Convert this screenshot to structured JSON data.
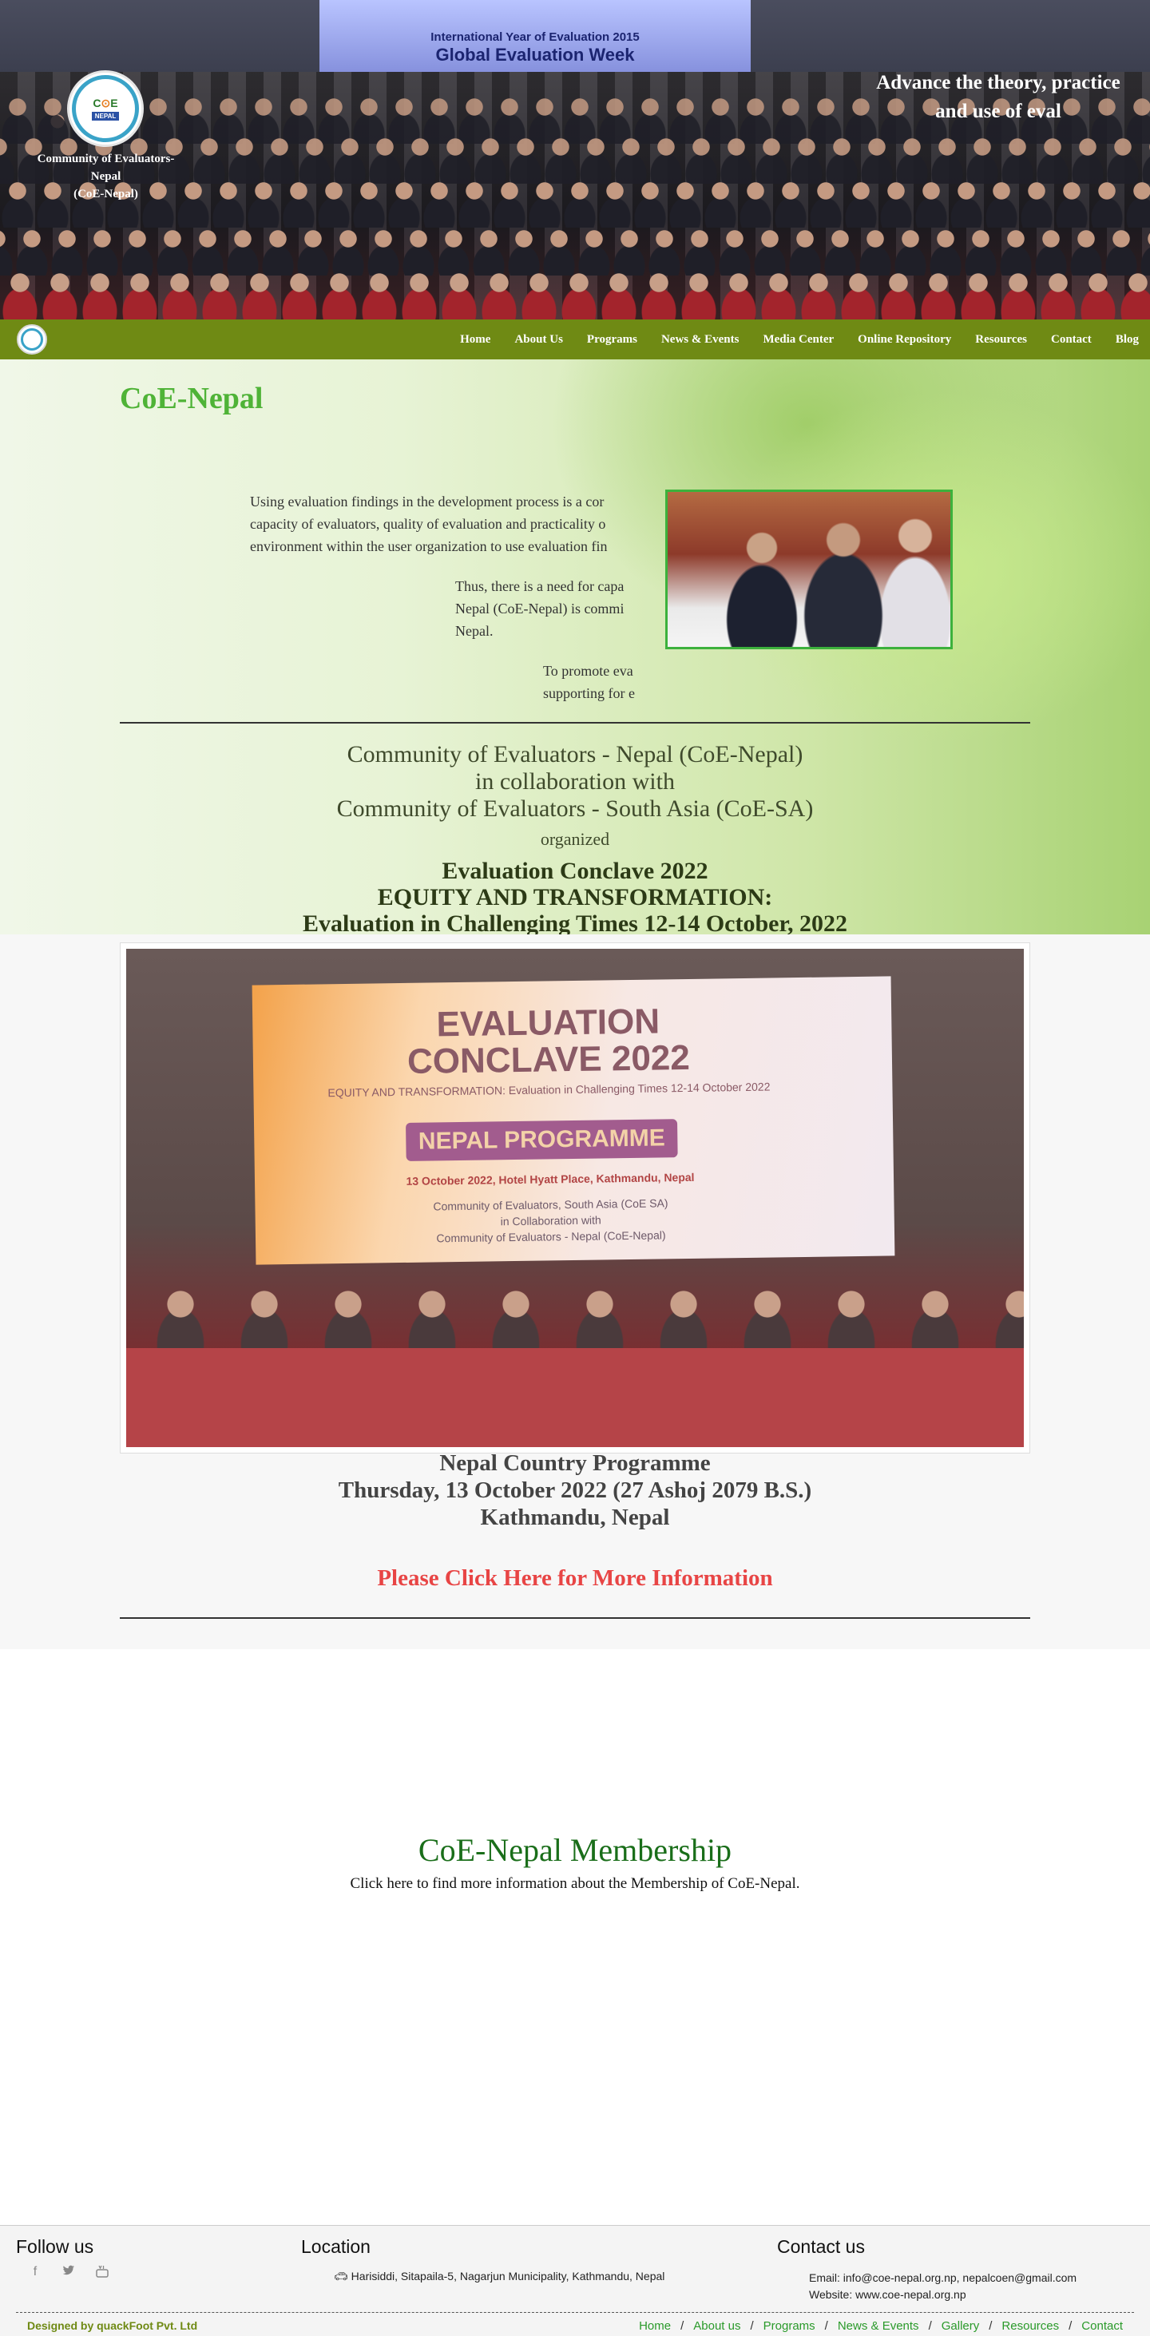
{
  "header": {
    "org_name_lines": [
      "Community of Evaluators-",
      "Nepal",
      "(CoE-Nepal)"
    ],
    "tagline_lines": [
      "Advance the theory, practice",
      "and use of eval"
    ],
    "hero_banner_lines": [
      "International Year of Evaluation 2015",
      "Global Evaluation Week"
    ],
    "logo_text": {
      "coe": "C",
      "coe_o": "⊙",
      "coe_e": "E",
      "nepal": "NEPAL"
    }
  },
  "nav": {
    "items": [
      "Home",
      "About Us",
      "Programs",
      "News & Events",
      "Media Center",
      "Online Repository",
      "Resources",
      "Contact",
      "Blog"
    ]
  },
  "main": {
    "title": "CoE-Nepal",
    "paragraphs": [
      [
        "Using evaluation findings in the development process is a cor",
        "capacity of evaluators, quality of evaluation and practicality o",
        "environment within the user organization to use evaluation fin"
      ],
      [
        "Thus, there is a need for capa",
        "Nepal (CoE-Nepal) is commi",
        "Nepal."
      ],
      [
        "To promote eva",
        "supporting for e"
      ]
    ],
    "announce_lines": [
      "Community of Evaluators - Nepal (CoE-Nepal)",
      "in collaboration with",
      "Community of Evaluators - South Asia (CoE-SA)"
    ],
    "organized": "organized",
    "event_lines": [
      "Evaluation Conclave 2022",
      "EQUITY AND TRANSFORMATION:",
      "Evaluation in Challenging Times 12-14 October, 2022"
    ]
  },
  "conclave_banner": {
    "title_lines": [
      "EVALUATION",
      "CONCLAVE 2022"
    ],
    "subtitle": "EQUITY AND TRANSFORMATION: Evaluation in Challenging Times  12-14 October 2022",
    "programme": "NEPAL PROGRAMME",
    "date_venue": "13 October 2022, Hotel Hyatt Place, Kathmandu, Nepal",
    "orgs_lines": [
      "Community of Evaluators, South Asia (CoE SA)",
      "in Collaboration with",
      "Community of Evaluators - Nepal (CoE-Nepal)"
    ]
  },
  "programme": {
    "lines": [
      "Nepal Country Programme",
      "Thursday, 13 October 2022 (27 Ashoj 2079 B.S.)",
      "Kathmandu, Nepal"
    ],
    "more_link": "Please Click Here for More Information"
  },
  "membership": {
    "title": "CoE-Nepal Membership",
    "text": "Click here to find more information about the Membership of CoE-Nepal."
  },
  "footer": {
    "follow_title": "Follow us",
    "social_icons": [
      "facebook-icon",
      "twitter-icon",
      "youtube-icon"
    ],
    "location_title": "Location",
    "address": "Harisiddi, Sitapaila-5, Nagarjun Municipality, Kathmandu, Nepal",
    "contact_title": "Contact us",
    "email": "Email: info@coe-nepal.org.np, nepalcoen@gmail.com",
    "website": "Website: www.coe-nepal.org.np",
    "designed_by": "Designed by quackFoot Pvt. Ltd",
    "links": [
      "Home",
      "About us",
      "Programs",
      "News & Events",
      "Gallery",
      "Resources",
      "Contact"
    ]
  },
  "colors": {
    "nav_green": "#6f8a14",
    "title_green": "#4fb337",
    "link_red": "#e84545",
    "membership_green": "#1a6e1a"
  }
}
